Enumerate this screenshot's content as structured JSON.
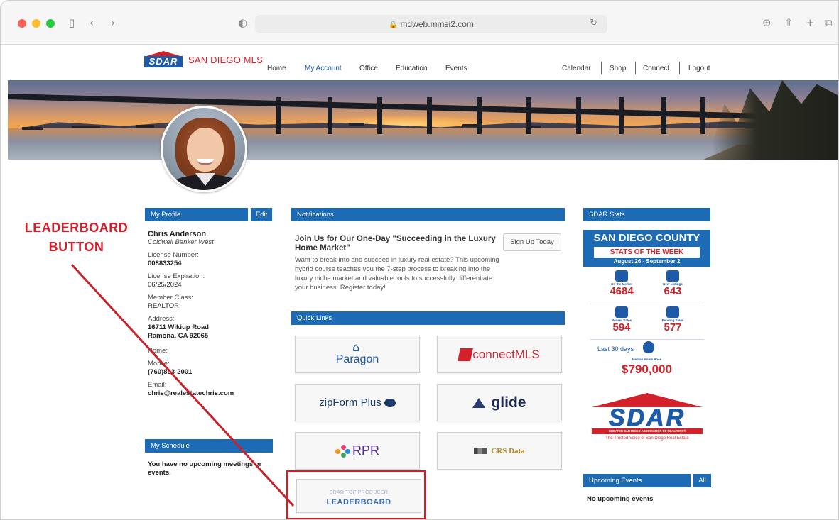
{
  "browser": {
    "url": "mdweb.mmsi2.com",
    "icons": [
      "sidebar-icon",
      "back-icon",
      "forward-icon",
      "privacy-icon",
      "reload-icon",
      "download-icon",
      "share-icon",
      "new-tab-icon",
      "tabs-icon"
    ]
  },
  "site": {
    "logo_text": "SDAR",
    "brand_left": "SAN DIEGO",
    "brand_sep": "|",
    "brand_right": "MLS",
    "nav": [
      "Home",
      "My Account",
      "Office",
      "Education",
      "Events"
    ],
    "nav_active": "My Account",
    "nav_right": [
      "Calendar",
      "Shop",
      "Connect",
      "Logout"
    ]
  },
  "profile": {
    "header": "My Profile",
    "edit_label": "Edit",
    "name": "Chris Anderson",
    "company": "Coldwell Banker West",
    "license_number_label": "License Number:",
    "license_number": "008833254",
    "license_expiration_label": "License Expiration:",
    "license_expiration": "06/25/2024",
    "member_class_label": "Member Class:",
    "member_class": "REALTOR",
    "address_label": "Address:",
    "address_line1": "16711 Wikiup Road",
    "address_line2": "Ramona, CA 92065",
    "home_label": "Home:",
    "mobile_label": "Mobile:",
    "mobile": "(760)803-2001",
    "email_label": "Email:",
    "email": "chris@realestatechris.com"
  },
  "schedule": {
    "header": "My Schedule",
    "text": "You have no upcoming meetings or events."
  },
  "notifications": {
    "header": "Notifications",
    "title": "Join Us for Our One-Day \"Succeeding in the Luxury Home Market\"",
    "body": "Want to break into and succeed in luxury real estate? This upcoming hybrid course teaches you the 7-step process to breaking into the luxury niche market and valuable tools to successfully differentiate your business. Register today!",
    "button": "Sign Up Today"
  },
  "quick_links": {
    "header": "Quick Links",
    "paragon": "Paragon",
    "connectmls": "connectMLS",
    "zipform": "zipForm Plus",
    "glide": "glide",
    "rpr": "RPR",
    "crs": "CRS Data",
    "leaderboard_small": "SDAR TOP PRODUCER",
    "leaderboard_big": "LEADERBOARD"
  },
  "stats": {
    "header": "SDAR Stats",
    "county": "SAN DIEGO COUNTY",
    "week": "STATS OF THE WEEK",
    "dates": "August 26 - September 2",
    "items": [
      {
        "label": "On the Market",
        "value": "4684"
      },
      {
        "label": "New Listings",
        "value": "643"
      },
      {
        "label": "Recent Sales",
        "value": "594"
      },
      {
        "label": "Pending Sales",
        "value": "577"
      }
    ],
    "last_days": "Last 30 days",
    "median_label": "Median Home Price",
    "median": "$790,000"
  },
  "sdar_logo": {
    "word": "SDAR",
    "band": "GREATER SAN DIEGO ASSOCIATION OF REALTORS®",
    "tagline": "The Trusted Voice of San Diego Real Estate"
  },
  "events": {
    "header": "Upcoming Events",
    "all_label": "All",
    "text": "No upcoming events"
  },
  "annotation": {
    "line1": "LEADERBOARD",
    "line2": "BUTTON",
    "color": "#d4202a"
  }
}
